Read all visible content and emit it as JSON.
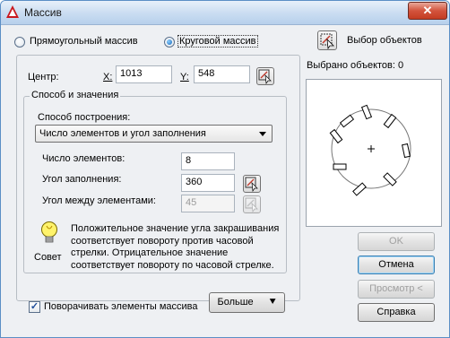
{
  "window": {
    "title": "Массив"
  },
  "array_type": {
    "rectangular_label": "Прямоугольный массив",
    "polar_label": "Круговой массив",
    "selected": "polar"
  },
  "center": {
    "label": "Центр:",
    "x_label": "X:",
    "x_value": "1013",
    "y_label": "Y:",
    "y_value": "548"
  },
  "method_group": {
    "title": "Способ и значения",
    "method_label": "Способ построения:",
    "method_value": "Число элементов и угол заполнения",
    "count_label": "Число элементов:",
    "count_value": "8",
    "fill_angle_label": "Угол заполнения:",
    "fill_angle_value": "360",
    "between_angle_label": "Угол между элементами:",
    "between_angle_value": "45"
  },
  "tip": {
    "text_line1": "Положительное значение угла закрашивания",
    "text_line2": "соответствует повороту против часовой",
    "text_line3": "стрелки. Отрицательное значение",
    "text_line4": "соответствует повороту по часовой стрелке.",
    "label": "Совет"
  },
  "rotate_items": {
    "label": "Поворачивать элементы массива",
    "checked": true
  },
  "more_button": {
    "label": "Больше",
    "icon": "double-chevron-down"
  },
  "select_objects": {
    "label": "Выбор объектов",
    "count_text": "Выбрано объектов: 0"
  },
  "buttons": {
    "ok": "OK",
    "cancel": "Отмена",
    "preview": "Просмотр <",
    "help": "Справка"
  },
  "colors": {
    "title_bar": "#c9dcf1",
    "close_button": "#d3533c",
    "dialog_bg": "#eef0f3"
  }
}
